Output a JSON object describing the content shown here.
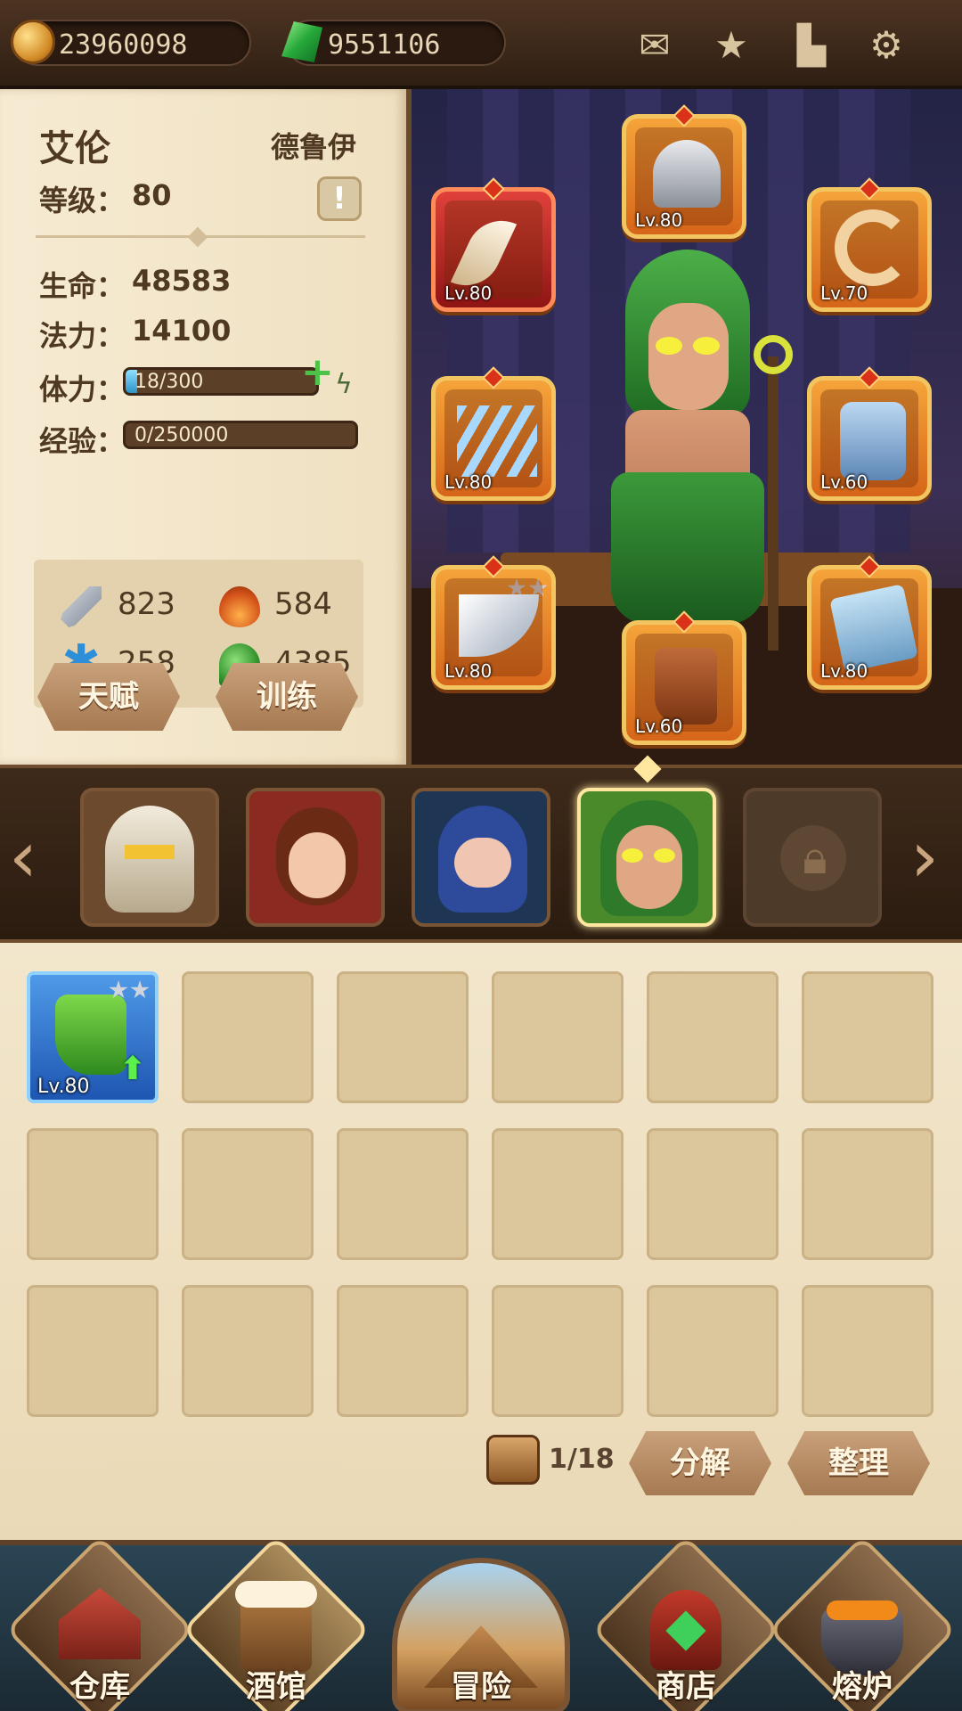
{
  "currency": {
    "gold": "23960098",
    "gems": "9551106"
  },
  "top_icons": [
    "mail-icon",
    "achievement-icon",
    "codex-icon",
    "settings-icon"
  ],
  "hero": {
    "name": "艾伦",
    "class": "德鲁伊",
    "level_label": "等级：",
    "level": "80",
    "hp_label": "生命：",
    "hp": "48583",
    "mp_label": "法力：",
    "mp": "14100",
    "stamina_label": "体力：",
    "stamina_text": "18/300",
    "stamina_fraction": 0.06,
    "exp_label": "经验：",
    "exp_text": "0/250000",
    "exp_fraction": 0.0,
    "attack": "823",
    "fire": "584",
    "ice": "258",
    "poison": "4385",
    "talent_button": "天赋",
    "train_button": "训练"
  },
  "equipment": [
    {
      "slot": "helmet",
      "level": "Lv.80"
    },
    {
      "slot": "fang",
      "level": "Lv.80"
    },
    {
      "slot": "horn",
      "level": "Lv.70"
    },
    {
      "slot": "claws",
      "level": "Lv.80"
    },
    {
      "slot": "armor",
      "level": "Lv.60"
    },
    {
      "slot": "blade",
      "level": "Lv.80"
    },
    {
      "slot": "boots",
      "level": "Lv.60"
    },
    {
      "slot": "book",
      "level": "Lv.80"
    }
  ],
  "heroes": [
    "paladin",
    "sorceress",
    "assassin",
    "druid",
    "locked"
  ],
  "inventory": {
    "items": [
      {
        "name": "green-boot",
        "level": "Lv.80"
      }
    ],
    "count": "1/18",
    "decompose_button": "分解",
    "sort_button": "整理"
  },
  "nav": {
    "warehouse": "仓库",
    "tavern": "酒馆",
    "adventure": "冒险",
    "shop": "商店",
    "forge": "熔炉"
  },
  "colors": {
    "panel": "#f2e6cc",
    "slot_orange": "#f5a43a",
    "slot_red": "#e0413a",
    "item_blue": "#3f87d8"
  }
}
